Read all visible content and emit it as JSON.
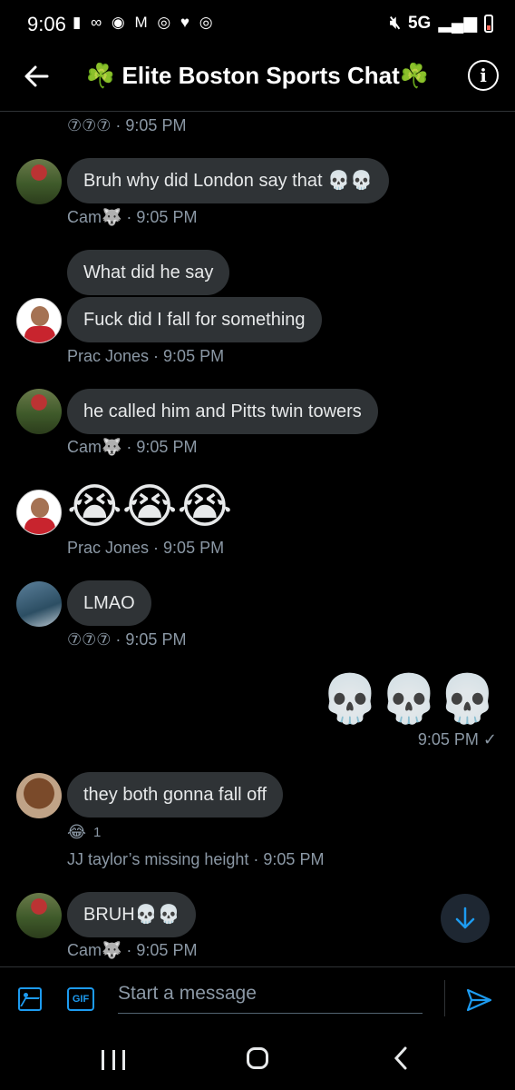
{
  "status_bar": {
    "time": "9:06",
    "left_icons": "▮ ∞ ◉ M ◎ ♥ ◎",
    "network": "5G"
  },
  "header": {
    "title": "Elite Boston Sports Chat",
    "clover": "☘️"
  },
  "messages": [
    {
      "meta": "⑦⑦⑦ · 9:05 PM"
    },
    {
      "sender": "Cam",
      "text": "Bruh why did London say that 💀💀",
      "meta": "Cam🐺 · 9:05 PM"
    },
    {
      "sender": "Prac Jones",
      "text": "What did he say"
    },
    {
      "sender": "Prac Jones",
      "text": "Fuck did I fall for something",
      "meta": "Prac Jones · 9:05 PM"
    },
    {
      "sender": "Cam",
      "text": "he called him and Pitts twin towers",
      "meta": "Cam🐺 · 9:05 PM"
    },
    {
      "sender": "Prac Jones",
      "text": "😭😭😭",
      "meta": "Prac Jones · 9:05 PM"
    },
    {
      "sender": "⑦⑦⑦",
      "text": "LMAO",
      "meta": "⑦⑦⑦ · 9:05 PM"
    },
    {
      "sender": "me",
      "text": "💀💀💀",
      "meta": "9:05 PM ✓"
    },
    {
      "sender": "JJ taylor’s missing height",
      "text": "they both gonna fall off",
      "reaction": "😂",
      "reaction_count": "1",
      "meta": "JJ taylor’s missing height · 9:05 PM"
    },
    {
      "sender": "Cam",
      "text": "BRUH💀💀",
      "meta": "Cam🐺 · 9:05 PM"
    }
  ],
  "compose": {
    "placeholder": "Start a message",
    "gif_label": "GIF"
  },
  "colors": {
    "accent": "#1d9bf0",
    "bubble": "#2f3336",
    "background": "#000000"
  }
}
